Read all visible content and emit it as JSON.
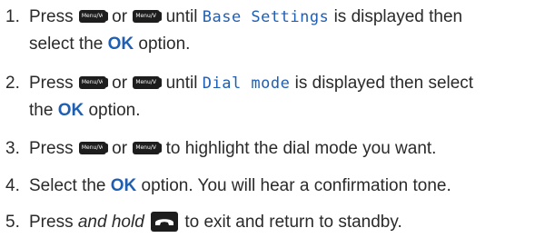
{
  "steps": [
    {
      "number": "1.",
      "line1_a": "Press ",
      "line1_or": " or ",
      "line1_until": " until ",
      "display_text": "Base Settings",
      "line1_end": " is displayed then",
      "line2_a": "select the ",
      "ok": "OK",
      "line2_end": " option."
    },
    {
      "number": "2.",
      "line1_a": "Press ",
      "line1_or": " or ",
      "line1_until": " until ",
      "display_text": "Dial mode",
      "line1_end": " is displayed then select",
      "line2_a": "the ",
      "ok": "OK",
      "line2_end": " option."
    },
    {
      "number": "3.",
      "line1_a": "Press ",
      "line1_or": " or ",
      "line1_end": " to highlight the dial mode you want."
    },
    {
      "number": "4.",
      "line1_a": "Select the ",
      "ok": "OK",
      "line1_end": " option. You will hear a confirmation tone."
    },
    {
      "number": "5.",
      "line1_a": "Press ",
      "emphasis": "and hold",
      "line1_end": " to exit and return to standby."
    }
  ],
  "keys": {
    "menu_up_label": "Menu/Vol+",
    "menu_down_label": "Menu/Vol-",
    "end_key_icon": "phone-hangup-icon"
  },
  "colors": {
    "text": "#2a2a2a",
    "accent": "#1f5fb3",
    "key": "#1d1d1d"
  }
}
